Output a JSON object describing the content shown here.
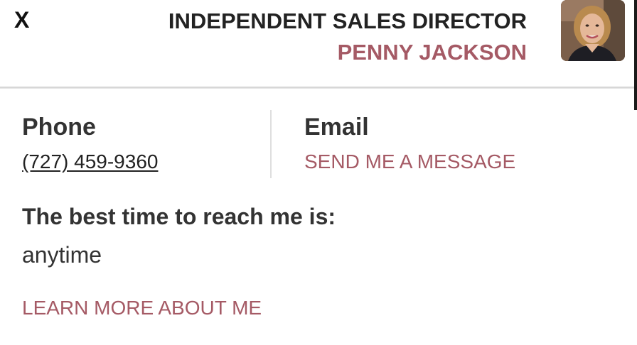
{
  "header": {
    "close_label": "X",
    "title": "INDEPENDENT SALES DIRECTOR",
    "name": "PENNY JACKSON",
    "avatar_icon": "profile-photo"
  },
  "contact": {
    "phone_label": "Phone",
    "phone_value": "(727) 459-9360",
    "email_label": "Email",
    "email_link": "SEND ME A MESSAGE"
  },
  "availability": {
    "label": "The best time to reach me is:",
    "value": "anytime"
  },
  "learn_more": "LEARN MORE ABOUT ME",
  "colors": {
    "accent": "#a55a65",
    "text": "#333333"
  }
}
